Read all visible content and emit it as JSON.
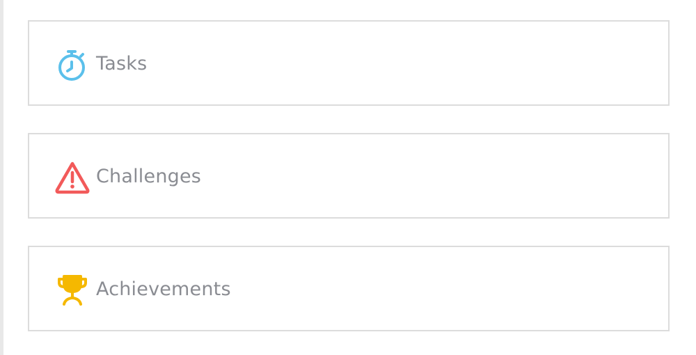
{
  "theme": {
    "label_color": "#8a8c92",
    "border_color": "#dcdcdc",
    "left_rule_color": "#e8e8e8"
  },
  "cards": [
    {
      "label": "Tasks",
      "icon": "stopwatch-icon",
      "icon_color": "#5bc0eb"
    },
    {
      "label": "Challenges",
      "icon": "warning-triangle-icon",
      "icon_color": "#f25a5a"
    },
    {
      "label": "Achievements",
      "icon": "trophy-icon",
      "icon_color": "#f5b800"
    }
  ]
}
